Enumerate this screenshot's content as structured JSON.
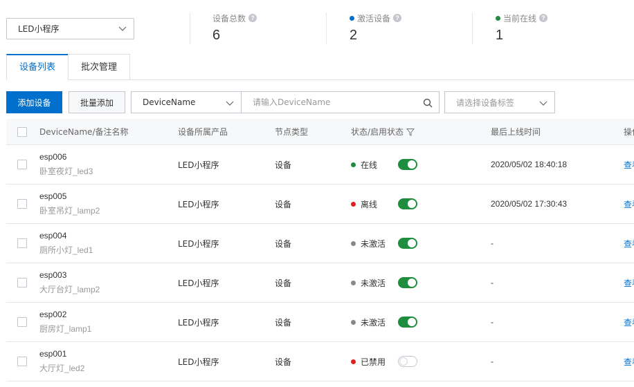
{
  "product_select": {
    "value": "LED小程序"
  },
  "stats": {
    "total": {
      "label": "设备总数",
      "value": "6"
    },
    "activated": {
      "label": "激活设备",
      "value": "2",
      "color": "#0070cc"
    },
    "online": {
      "label": "当前在线",
      "value": "1",
      "color": "#1e8e3e"
    }
  },
  "tabs": [
    {
      "label": "设备列表",
      "active": true
    },
    {
      "label": "批次管理",
      "active": false
    }
  ],
  "toolbar": {
    "add_label": "添加设备",
    "batch_add_label": "批量添加",
    "field_select_value": "DeviceName",
    "search_placeholder": "请输入DeviceName",
    "tag_placeholder": "请选择设备标签"
  },
  "table": {
    "headers": {
      "name": "DeviceName/备注名称",
      "product": "设备所属产品",
      "node_type": "节点类型",
      "status": "状态/启用状态",
      "last_online": "最后上线时间",
      "actions": "操作"
    },
    "rows": [
      {
        "name": "esp006",
        "alias": "卧室夜灯_led3",
        "product": "LED小程序",
        "node_type": "设备",
        "status": "在线",
        "status_color": "#1e8e3e",
        "enabled": true,
        "last_online": "2020/05/02 18:40:18",
        "action": "查看"
      },
      {
        "name": "esp005",
        "alias": "卧室吊灯_lamp2",
        "product": "LED小程序",
        "node_type": "设备",
        "status": "离线",
        "status_color": "#e02020",
        "enabled": true,
        "last_online": "2020/05/02 17:30:43",
        "action": "查看"
      },
      {
        "name": "esp004",
        "alias": "厕所小灯_led1",
        "product": "LED小程序",
        "node_type": "设备",
        "status": "未激活",
        "status_color": "#888888",
        "enabled": true,
        "last_online": "-",
        "action": "查看"
      },
      {
        "name": "esp003",
        "alias": "大厅台灯_lamp2",
        "product": "LED小程序",
        "node_type": "设备",
        "status": "未激活",
        "status_color": "#888888",
        "enabled": true,
        "last_online": "-",
        "action": "查看"
      },
      {
        "name": "esp002",
        "alias": "厨房灯_lamp1",
        "product": "LED小程序",
        "node_type": "设备",
        "status": "未激活",
        "status_color": "#888888",
        "enabled": true,
        "last_online": "-",
        "action": "查看"
      },
      {
        "name": "esp001",
        "alias": "大厅灯_led2",
        "product": "LED小程序",
        "node_type": "设备",
        "status": "已禁用",
        "status_color": "#e02020",
        "enabled": false,
        "last_online": "-",
        "action": "查看"
      }
    ]
  }
}
